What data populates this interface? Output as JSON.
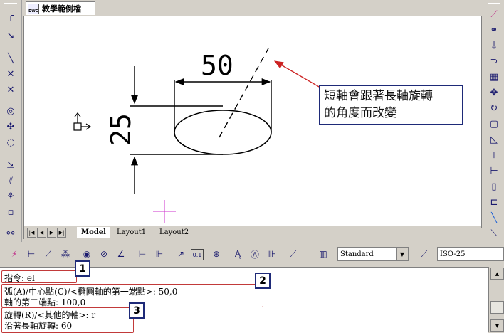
{
  "document_tab": {
    "icon_text": "DWG",
    "title": "教學範例檔"
  },
  "layout_tabs": {
    "model": "Model",
    "layout1": "Layout1",
    "layout2": "Layout2"
  },
  "drawing": {
    "dimension_horizontal": "50",
    "dimension_vertical": "25",
    "annotation": {
      "line1": "短軸會跟著長軸旋轉",
      "line2": "的角度而改變"
    }
  },
  "toolbar_bottom": {
    "dimstyle_value": "Standard",
    "dimstyle2_value": "ISO-25",
    "scale_icon_text": "0.1"
  },
  "command_lines": [
    {
      "text": "指令: el"
    },
    {
      "text": "弧(A)/中心點(C)/<橢圓軸的第一端點>: 50,0"
    },
    {
      "text": "軸的第二端點: 100,0"
    },
    {
      "text": "旋轉(R)/<其他的軸>: r"
    },
    {
      "text": "沿著長軸旋轉: 60"
    }
  ],
  "callouts": [
    "1",
    "2",
    "3"
  ],
  "colors": {
    "highlight": "#c23a3a",
    "callout_border": "#1e2a78",
    "annotation_arrow": "#cc2222",
    "cursor": "#cc33cc"
  }
}
